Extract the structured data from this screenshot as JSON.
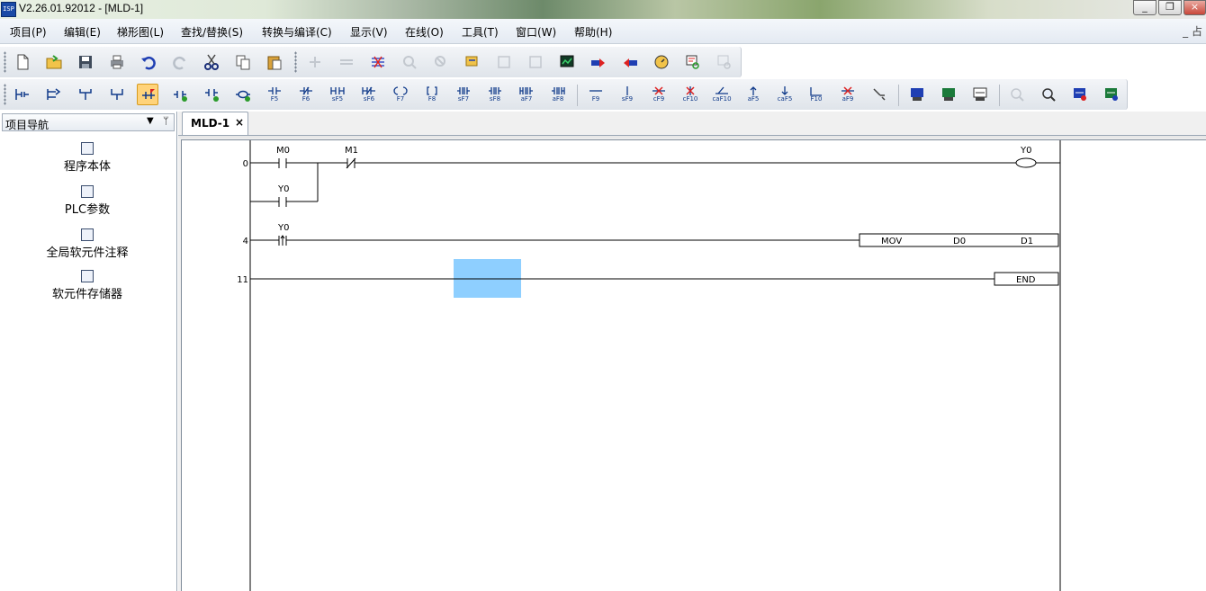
{
  "window": {
    "title": "V2.26.01.92012 - [MLD-1]",
    "icon_text": "ISPSoft"
  },
  "menu": {
    "items": [
      "项目(P)",
      "编辑(E)",
      "梯形图(L)",
      "查找/替换(S)",
      "转换与编译(C)",
      "显示(V)",
      "在线(O)",
      "工具(T)",
      "窗口(W)",
      "帮助(H)"
    ],
    "right_glyph": "_ 占"
  },
  "toolbar2_labels": [
    "F5",
    "F6",
    "sF5",
    "sF6",
    "F7",
    "F8",
    "sF7",
    "sF8",
    "aF7",
    "aF8",
    "F9",
    "sF9",
    "cF9",
    "cF10",
    "caF10",
    "aF5",
    "caF5",
    "F10",
    "aF9"
  ],
  "navigator": {
    "title": "项目导航",
    "items": [
      {
        "label": "程序本体",
        "icon": "program-icon"
      },
      {
        "label": "PLC参数",
        "icon": "parameter-icon"
      },
      {
        "label": "全局软元件注释",
        "icon": "comment-icon"
      },
      {
        "label": "软元件存储器",
        "icon": "memory-icon"
      }
    ]
  },
  "tab": {
    "label": "MLD-1",
    "close": "×"
  },
  "ladder": {
    "rungs": [
      {
        "step": "0",
        "contacts": [
          {
            "device": "M0",
            "type": "NO"
          },
          {
            "device": "M1",
            "type": "NC"
          }
        ],
        "branch": {
          "device": "Y0",
          "type": "NO"
        },
        "coil": "Y0"
      },
      {
        "step": "4",
        "contacts": [
          {
            "device": "Y0",
            "type": "rising-edge"
          }
        ],
        "instruction": {
          "op": "MOV",
          "src": "D0",
          "dst": "D1"
        }
      },
      {
        "step": "11",
        "instruction": {
          "op": "END"
        }
      }
    ]
  },
  "colors": {
    "selection": "#8ecfff",
    "active_button": "#ffd37a"
  }
}
